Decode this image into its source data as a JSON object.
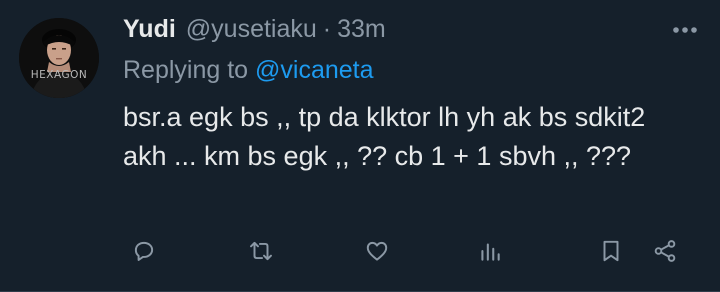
{
  "author": {
    "name": "Yudi",
    "handle": "@yusetiaku",
    "separator": "·",
    "time": "33m",
    "avatar_text": "HEXAGON"
  },
  "reply": {
    "prefix": "Replying to",
    "mention": "@vicaneta"
  },
  "body": {
    "text": "bsr.a egk bs ,, tp da klktor lh yh ak bs sdkit2 akh ... km bs egk ,, ?? cb 1 + 1 sbvh ,, ???"
  },
  "actions": [
    {
      "icon": "reply-icon"
    },
    {
      "icon": "retweet-icon"
    },
    {
      "icon": "like-icon"
    },
    {
      "icon": "views-icon"
    },
    {
      "icon": "bookmark-icon"
    },
    {
      "icon": "share-icon"
    }
  ],
  "colors": {
    "background": "#15202b",
    "primary_text": "#e7e9ea",
    "secondary_text": "#8b98a5",
    "accent": "#1d9bf0"
  }
}
